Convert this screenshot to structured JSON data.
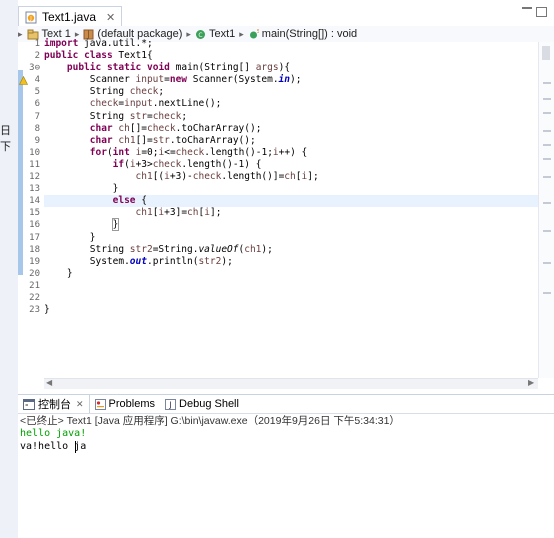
{
  "left_edge": {
    "label": "日 下"
  },
  "editor_tab": {
    "title": "Text1.java",
    "close": "✕"
  },
  "breadcrumb": [
    {
      "label": "Text 1",
      "icon": "project-icon"
    },
    {
      "label": "(default package)",
      "icon": "package-icon"
    },
    {
      "label": "Text1",
      "icon": "class-icon"
    },
    {
      "label": "main(String[]) : void",
      "icon": "method-icon"
    }
  ],
  "line_numbers": [
    "1",
    "2",
    "3⊖",
    "4",
    "5",
    "6",
    "7",
    "8",
    "9",
    "10",
    "11",
    "12",
    "13",
    "14",
    "15",
    "16",
    "17",
    "18",
    "19",
    "20",
    "21",
    "22",
    "23"
  ],
  "code_lines": [
    "import java.util.*;",
    "public class Text1{",
    "    public static void main(String[] args){",
    "        Scanner input=new Scanner(System.in);",
    "        String check;",
    "        check=input.nextLine();",
    "        String str=check;",
    "        char ch[]=check.toCharArray();",
    "        char ch1[]=str.toCharArray();",
    "        for(int i=0;i<=check.length()-1;i++) {",
    "            if(i+3>check.length()-1) {",
    "                ch1[(i+3)-check.length()]=ch[i];",
    "            }",
    "            else {",
    "                ch1[i+3]=ch[i];",
    "            }",
    "        }",
    "        String str2=String.valueOf(ch1);",
    "        System.out.println(str2);",
    "    }",
    "",
    "",
    "}"
  ],
  "view_tabs": [
    {
      "label": "控制台",
      "icon": "console-icon",
      "close": "✕"
    },
    {
      "label": "Problems",
      "icon": "problems-icon"
    },
    {
      "label": "Debug Shell",
      "icon": "debug-shell-icon"
    }
  ],
  "console": {
    "status": "<已终止> Text1 [Java 应用程序] G:\\bin\\javaw.exe（2019年9月26日 下午5:34:31）",
    "input_line": "hello java!",
    "output_line": "va!hello ja"
  },
  "colors": {
    "keyword": "#7f0055",
    "field": "#0000c0",
    "local_variable": "#6a3e3e",
    "console_input": "#00a000",
    "current_line": "#e8f2fe"
  }
}
